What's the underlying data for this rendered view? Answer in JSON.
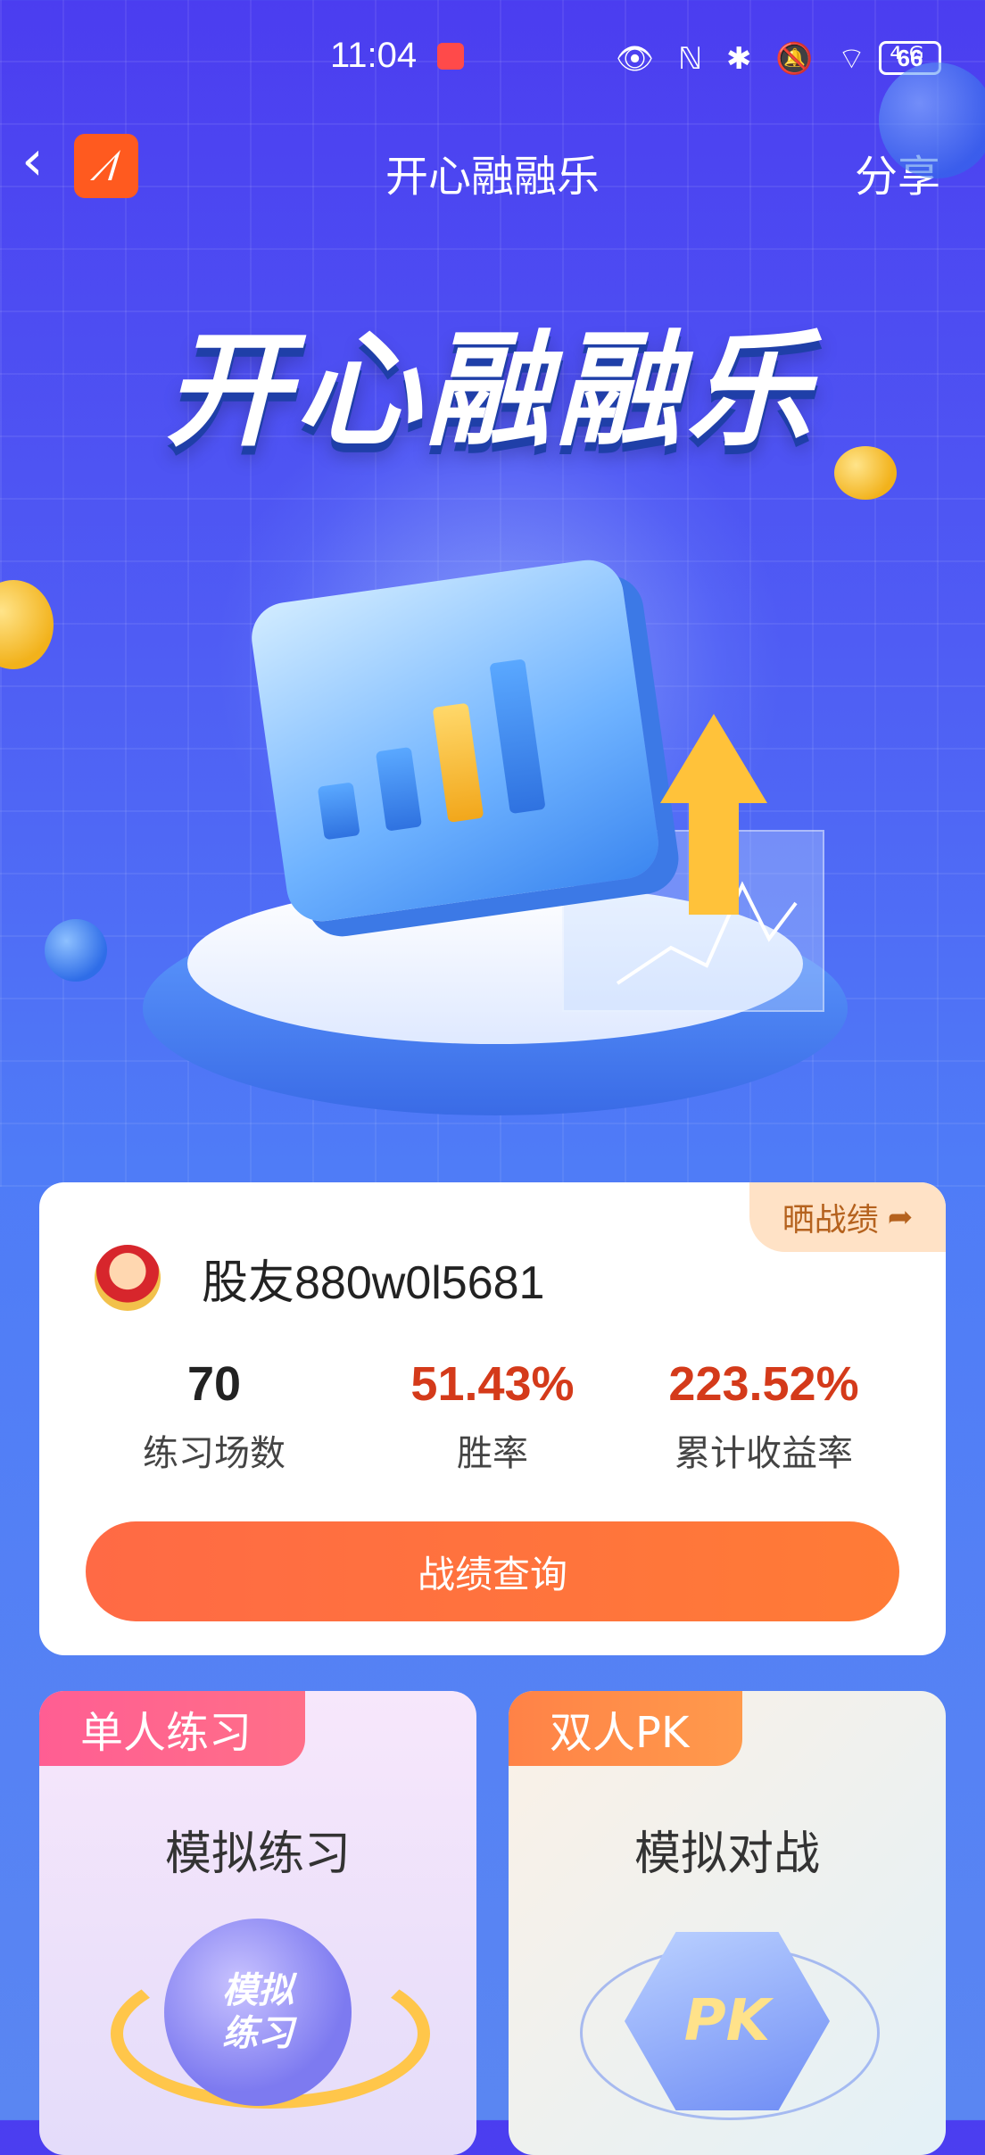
{
  "status_bar": {
    "time": "11:04",
    "icons": "👁 ℕ ✱ 🔕 ⌔ ⁴ᴳ",
    "battery": "66"
  },
  "nav": {
    "back_icon": "‹",
    "title": "开心融融乐",
    "share": "分享"
  },
  "hero": {
    "title": "开心融融乐"
  },
  "profile": {
    "show_results": "晒战绩",
    "username": "股友880w0l5681",
    "stats": [
      {
        "value": "70",
        "label": "练习场数",
        "color": "#222222"
      },
      {
        "value": "51.43%",
        "label": "胜率",
        "color": "#d43a1a"
      },
      {
        "value": "223.52%",
        "label": "累计收益率",
        "color": "#d43a1a"
      }
    ],
    "query_button": "战绩查询"
  },
  "modes": {
    "single": {
      "tag": "单人练习",
      "title": "模拟练习",
      "emblem_text": "模拟\n练习"
    },
    "double": {
      "tag": "双人PK",
      "title": "模拟对战",
      "emblem_text": "PK"
    }
  }
}
